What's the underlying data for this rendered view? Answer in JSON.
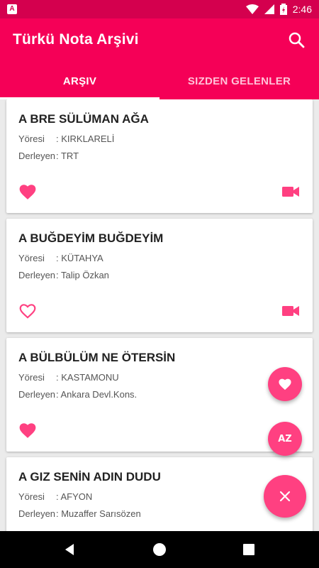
{
  "status_bar": {
    "time": "2:46",
    "app_badge": "A"
  },
  "app_bar": {
    "title": "Türkü Nota Arşivi",
    "search_icon": "search-icon"
  },
  "tabs": [
    {
      "label": "ARŞIV",
      "active": true
    },
    {
      "label": "SIZDEN GELENLER",
      "active": false
    }
  ],
  "cards": [
    {
      "title": "A BRE SÜLÜMAN AĞA",
      "region_key": "Yöresi",
      "region_value": ": KIRKLARELİ",
      "collector_key": "Derleyen",
      "collector_value": ": TRT",
      "favorite": true
    },
    {
      "title": "A BUĞDEYİM BUĞDEYİM",
      "region_key": "Yöresi",
      "region_value": ": KÜTAHYA",
      "collector_key": "Derleyen",
      "collector_value": ": Talip Özkan",
      "favorite": false
    },
    {
      "title": "A BÜLBÜLÜM NE ÖTERSİN",
      "region_key": "Yöresi",
      "region_value": ": KASTAMONU",
      "collector_key": "Derleyen",
      "collector_value": ": Ankara Devl.Kons.",
      "favorite": true
    },
    {
      "title": "A GIZ SENİN ADIN DUDU",
      "region_key": "Yöresi",
      "region_value": ": AFYON",
      "collector_key": "Derleyen",
      "collector_value": ": Muzaffer Sarısözen",
      "favorite": false
    }
  ],
  "fab": {
    "sort_label": "AZ",
    "favorites_icon": "heart-icon",
    "close_icon": "close-icon"
  },
  "colors": {
    "primary": "#f50057",
    "status": "#d4004e",
    "accent": "#ff4081"
  }
}
